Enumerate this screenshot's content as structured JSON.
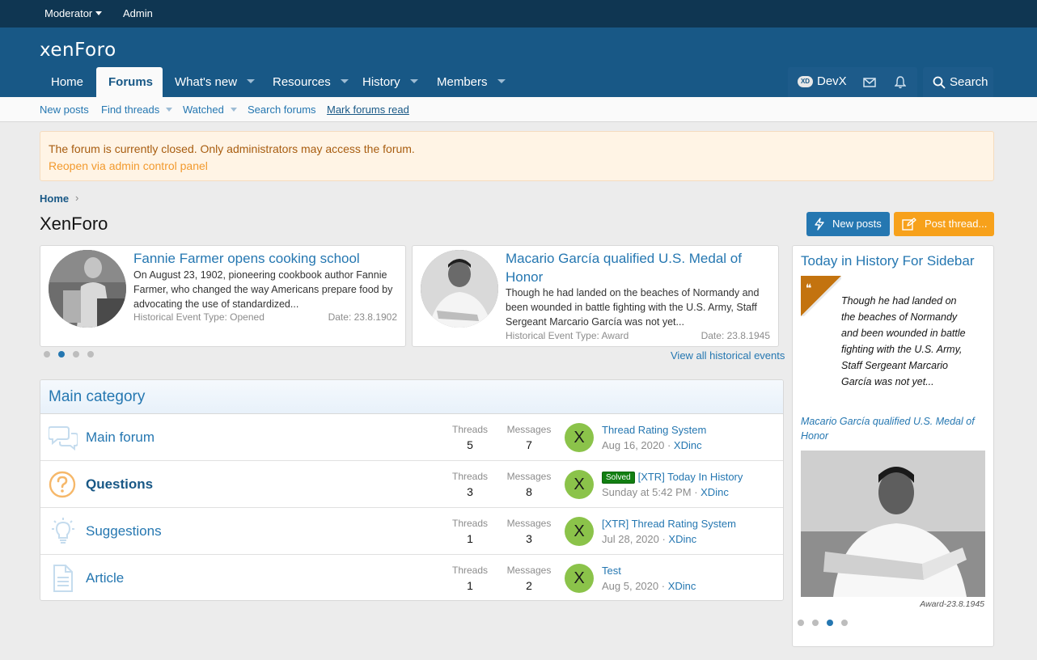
{
  "staffbar": {
    "moderator": "Moderator",
    "admin": "Admin"
  },
  "header": {
    "logo": "xenForo"
  },
  "nav": {
    "tabs": [
      {
        "label": "Home"
      },
      {
        "label": "Forums"
      },
      {
        "label": "What's new"
      },
      {
        "label": "Resources"
      },
      {
        "label": "History"
      },
      {
        "label": "Members"
      }
    ],
    "user": "DevX",
    "search": "Search"
  },
  "subnav": {
    "items": [
      "New posts",
      "Find threads",
      "Watched",
      "Search forums",
      "Mark forums read"
    ]
  },
  "notice": {
    "text": "The forum is currently closed. Only administrators may access the forum.",
    "link": "Reopen via admin control panel"
  },
  "breadcrumb": {
    "home": "Home"
  },
  "page": {
    "title": "XenForo"
  },
  "buttons": {
    "new_posts": "New posts",
    "post_thread": "Post thread..."
  },
  "slider": {
    "cards": [
      {
        "title": "Fannie Farmer opens cooking school",
        "desc": "On August 23, 1902, pioneering cookbook author Fannie Farmer, who changed the way Americans prepare food by advocating the use of standardized...",
        "meta": "Historical Event Type: Opened",
        "date": "Date: 23.8.1902"
      },
      {
        "title": "Macario García qualified U.S. Medal of Honor",
        "desc": "Though he had landed on the beaches of Normandy and been wounded in battle fighting with the U.S. Army, Staff Sergeant Marcario García was not yet...",
        "meta": "Historical Event Type: Award",
        "date": "Date: 23.8.1945"
      }
    ],
    "view_all": "View all historical events"
  },
  "category": {
    "title": "Main category",
    "threads_label": "Threads",
    "messages_label": "Messages",
    "forums": [
      {
        "name": "Main forum",
        "threads": "5",
        "messages": "7",
        "avatar": "X",
        "last_title": "Thread Rating System",
        "last_date": "Aug 16, 2020",
        "last_user": "XDinc",
        "prefix": ""
      },
      {
        "name": "Questions",
        "threads": "3",
        "messages": "8",
        "avatar": "X",
        "last_title": "[XTR] Today In History",
        "last_date": "Sunday at 5:42 PM",
        "last_user": "XDinc",
        "prefix": "Solved"
      },
      {
        "name": "Suggestions",
        "threads": "1",
        "messages": "3",
        "avatar": "X",
        "last_title": "[XTR] Thread Rating System",
        "last_date": "Jul 28, 2020",
        "last_user": "XDinc",
        "prefix": ""
      },
      {
        "name": "Article",
        "threads": "1",
        "messages": "2",
        "avatar": "X",
        "last_title": "Test",
        "last_date": "Aug 5, 2020",
        "last_user": "XDinc",
        "prefix": ""
      }
    ]
  },
  "sidebar": {
    "title": "Today in History For Sidebar",
    "quote": "Though he had landed on the beaches of Normandy and been wounded in battle fighting with the U.S. Army, Staff Sergeant Marcario García was not yet...",
    "link": "Macario García qualified U.S. Medal of Honor",
    "caption": "Award-23.8.1945"
  },
  "colors": {
    "staffbar": "#0f3652",
    "header": "#185886",
    "link": "#2577b1",
    "accent_orange": "#f7a11b",
    "solved": "#127f12"
  }
}
